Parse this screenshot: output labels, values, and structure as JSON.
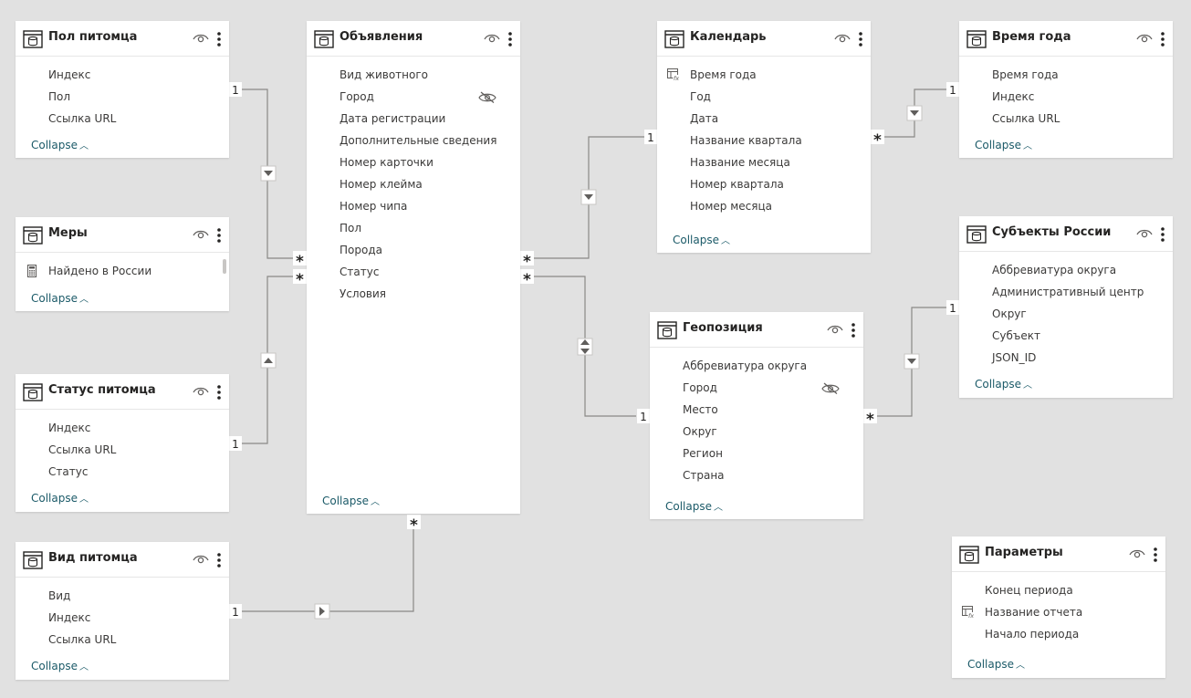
{
  "tables": {
    "pol_pitomca": {
      "title": "Пол питомца",
      "fields": [
        "Индекс",
        "Пол",
        "Ссылка URL"
      ],
      "collapse": "Collapse"
    },
    "mery": {
      "title": "Меры",
      "fields": [
        "Найдено в России"
      ],
      "collapse": "Collapse"
    },
    "status_pitomca": {
      "title": "Статус питомца",
      "fields": [
        "Индекс",
        "Ссылка URL",
        "Статус"
      ],
      "collapse": "Collapse"
    },
    "vid_pitomca": {
      "title": "Вид питомца",
      "fields": [
        "Вид",
        "Индекс",
        "Ссылка URL"
      ],
      "collapse": "Collapse"
    },
    "obyavleniya": {
      "title": "Объявления",
      "fields": [
        "Вид животного",
        "Город",
        "Дата регистрации",
        "Дополнительные сведения",
        "Номер карточки",
        "Номер клейма",
        "Номер чипа",
        "Пол",
        "Порода",
        "Статус",
        "Условия"
      ],
      "collapse": "Collapse"
    },
    "kalendar": {
      "title": "Календарь",
      "fields": [
        "Время года",
        "Год",
        "Дата",
        "Название квартала",
        "Название месяца",
        "Номер квартала",
        "Номер месяца"
      ],
      "collapse": "Collapse"
    },
    "geopoziciya": {
      "title": "Геопозиция",
      "fields": [
        "Аббревиатура округа",
        "Город",
        "Место",
        "Округ",
        "Регион",
        "Страна"
      ],
      "collapse": "Collapse"
    },
    "vremya_goda": {
      "title": "Время года",
      "fields": [
        "Время года",
        "Индекс",
        "Ссылка URL"
      ],
      "collapse": "Collapse"
    },
    "subekty": {
      "title": "Субъекты России",
      "fields": [
        "Аббревиатура округа",
        "Административный центр",
        "Округ",
        "Субъект",
        "JSON_ID"
      ],
      "collapse": "Collapse"
    },
    "parametry": {
      "title": "Параметры",
      "fields": [
        "Конец периода",
        "Название отчета",
        "Начало периода"
      ],
      "collapse": "Collapse"
    }
  },
  "cardinality": {
    "one": "1",
    "many": "*"
  },
  "colors": {
    "canvas": "#e1e1e1",
    "card": "#ffffff",
    "line": "#8a8886",
    "link": "#1b5a68"
  },
  "icons": {
    "table": "table-icon",
    "visibility": "eye-icon",
    "more": "more-options-icon",
    "hidden": "eye-slash-icon",
    "measure": "calculator-icon",
    "calculated": "calculated-column-icon",
    "filter_single": "single-direction-arrow-icon",
    "filter_both": "bidirectional-arrow-icon"
  }
}
